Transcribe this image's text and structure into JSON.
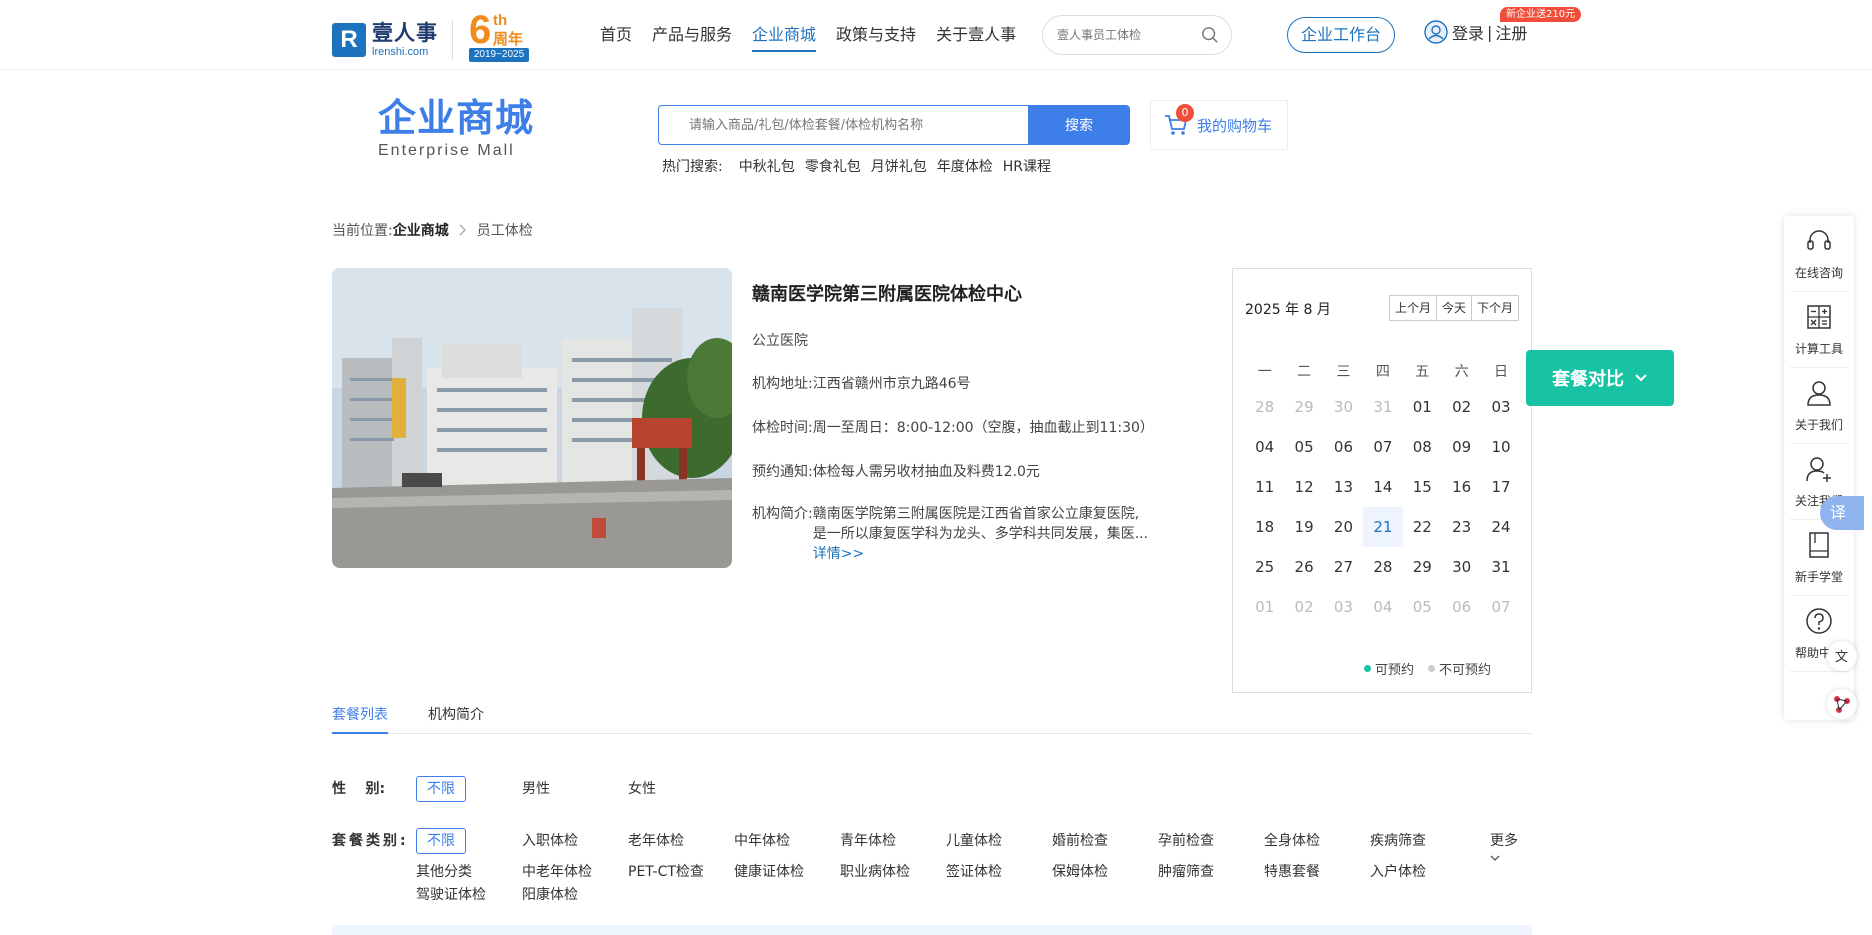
{
  "logo": {
    "mark": "R",
    "name": "壹人事",
    "domain": "lrenshi.com"
  },
  "anniversary": {
    "num": "6",
    "suffix": "th",
    "label": "周年",
    "years": "2019~2025"
  },
  "nav": {
    "items": [
      "首页",
      "产品与服务",
      "企业商城",
      "政策与支持",
      "关于壹人事"
    ],
    "active_index": 2
  },
  "top_search": {
    "placeholder": "壹人事员工体检"
  },
  "header": {
    "workbench": "企业工作台",
    "login": "登录",
    "divider": "|",
    "register": "注册",
    "promo": "新企业送210元"
  },
  "mall": {
    "title_cn": "企业商城",
    "title_en": "Enterprise  Mall"
  },
  "main_search": {
    "placeholder": "请输入商品/礼包/体检套餐/体检机构名称",
    "button": "搜索"
  },
  "cart": {
    "label": "我的购物车",
    "count": "0"
  },
  "hot_search": {
    "label": "热门搜索:",
    "items": [
      "中秋礼包",
      "零食礼包",
      "月饼礼包",
      "年度体检",
      "HR课程"
    ]
  },
  "breadcrumb": {
    "prefix": "当前位置:",
    "items": [
      "企业商城",
      "员工体检"
    ]
  },
  "hospital": {
    "name": "赣南医学院第三附属医院体检中心",
    "type": "公立医院",
    "address_label": "机构地址:",
    "address": "江西省赣州市京九路46号",
    "hours_label": "体检时间:",
    "hours": "周一至周日：8:00-12:00（空腹，抽血截止到11:30）",
    "notice_label": "预约通知:",
    "notice": "体检每人需另收材抽血及料费12.0元",
    "intro_label": "机构简介:",
    "intro_line1": "赣南医学院第三附属医院是江西省首家公立康复医院,",
    "intro_line2": "是一所以康复医学科为龙头、多学科共同发展，集医...",
    "more": "详情>>"
  },
  "calendar": {
    "title": "2025 年 8 月",
    "buttons": [
      "上个月",
      "今天",
      "下个月"
    ],
    "weekdays": [
      "一",
      "二",
      "三",
      "四",
      "五",
      "六",
      "日"
    ],
    "weeks": [
      [
        "28",
        "29",
        "30",
        "31",
        "01",
        "02",
        "03"
      ],
      [
        "04",
        "05",
        "06",
        "07",
        "08",
        "09",
        "10"
      ],
      [
        "11",
        "12",
        "13",
        "14",
        "15",
        "16",
        "17"
      ],
      [
        "18",
        "19",
        "20",
        "21",
        "22",
        "23",
        "24"
      ],
      [
        "25",
        "26",
        "27",
        "28",
        "29",
        "30",
        "31"
      ],
      [
        "01",
        "02",
        "03",
        "04",
        "05",
        "06",
        "07"
      ]
    ],
    "today": "21",
    "legend_available": "可预约",
    "legend_unavailable": "不可预约",
    "available_color": "#18c3a4",
    "unavailable_color": "#cccccc"
  },
  "compare": {
    "label": "套餐对比"
  },
  "tabs": {
    "items": [
      "套餐列表",
      "机构简介"
    ],
    "active_index": 0
  },
  "filters": {
    "gender_label": "性    别:",
    "gender_options": [
      "不限",
      "男性",
      "女性"
    ],
    "category_label": "套餐类别:",
    "category_options": [
      "不限",
      "入职体检",
      "老年体检",
      "中年体检",
      "青年体检",
      "儿童体检",
      "婚前检查",
      "孕前检查",
      "全身体检",
      "疾病筛查"
    ],
    "category_row2": [
      "其他分类",
      "中老年体检",
      "PET-CT检查",
      "健康证体检",
      "职业病体检",
      "签证体检",
      "保姆体检",
      "肿瘤筛查",
      "特惠套餐",
      "入户体检"
    ],
    "category_row3": [
      "驾驶证体检",
      "阳康体检"
    ],
    "more": "更多"
  },
  "sidebar": {
    "items": [
      {
        "label": "在线咨询",
        "icon": "headset-icon"
      },
      {
        "label": "计算工具",
        "icon": "calculator-icon"
      },
      {
        "label": "关于我们",
        "icon": "user-icon"
      },
      {
        "label": "关注我们",
        "icon": "user-add-icon"
      },
      {
        "label": "新手学堂",
        "icon": "book-icon"
      },
      {
        "label": "帮助中心",
        "icon": "help-icon"
      }
    ],
    "translate": "译"
  },
  "colors": {
    "brand": "#1e73be",
    "accent": "#3d7ee8",
    "teal": "#18c3a4",
    "orange": "#f08c1e"
  }
}
